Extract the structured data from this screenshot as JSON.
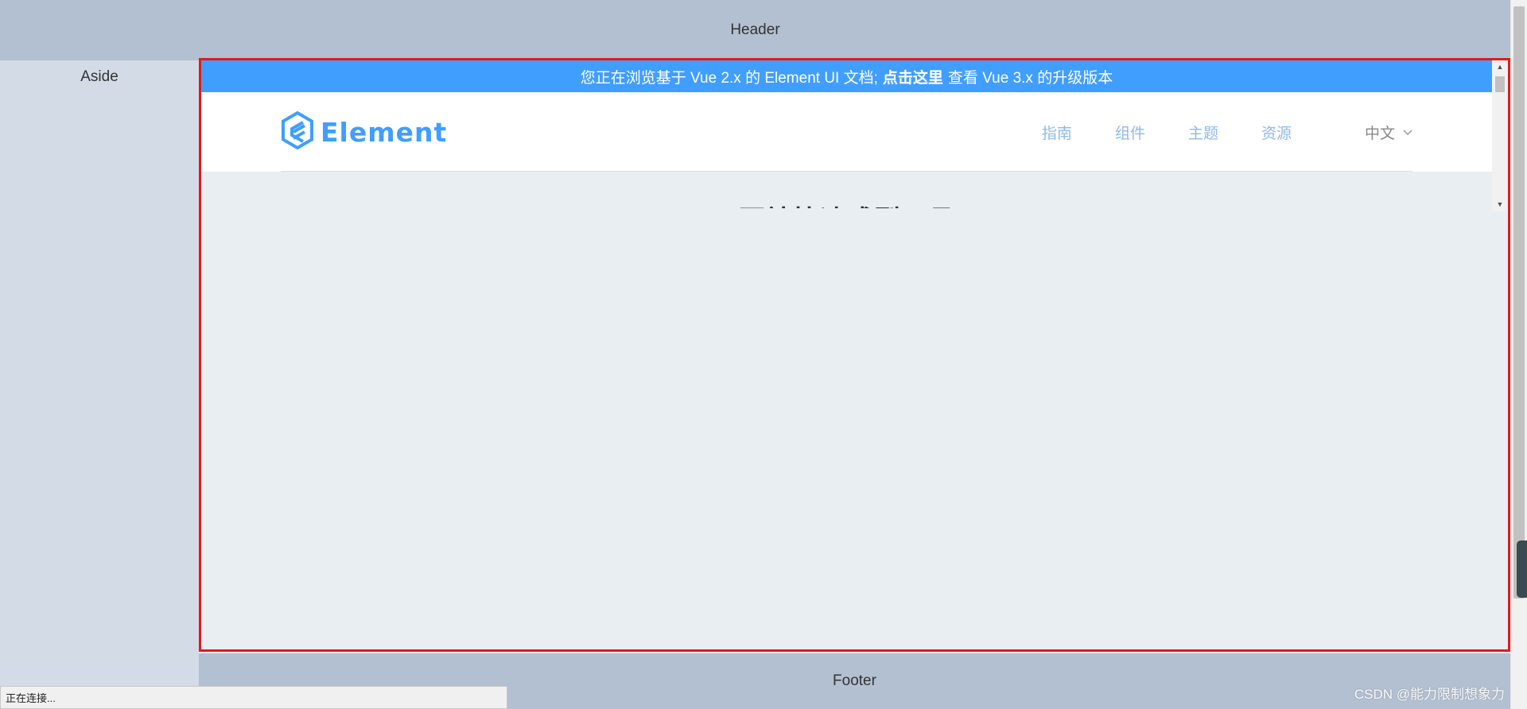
{
  "layout": {
    "header": "Header",
    "aside": "Aside",
    "footer": "Footer"
  },
  "embedded_page": {
    "banner": {
      "prefix": "您正在浏览基于 Vue 2.x 的 Element UI 文档;",
      "link": "点击这里",
      "suffix": "查看 Vue 3.x 的升级版本"
    },
    "logo_text": "Element",
    "nav": [
      "指南",
      "组件",
      "主题",
      "资源"
    ],
    "language": "中文",
    "hero_title": "网站快速成型工具"
  },
  "status_bar": "正在连接...",
  "watermark": "CSDN @能力限制想象力",
  "colors": {
    "accent": "#409eff",
    "highlight_border": "#e21a1a",
    "header_bg": "#b3c0d1",
    "aside_bg": "#d3dce6",
    "main_bg": "#e9eef3"
  },
  "icons": [
    "element-logo-icon",
    "chevron-down-icon",
    "scroll-up-arrow-icon",
    "scroll-down-arrow-icon"
  ]
}
